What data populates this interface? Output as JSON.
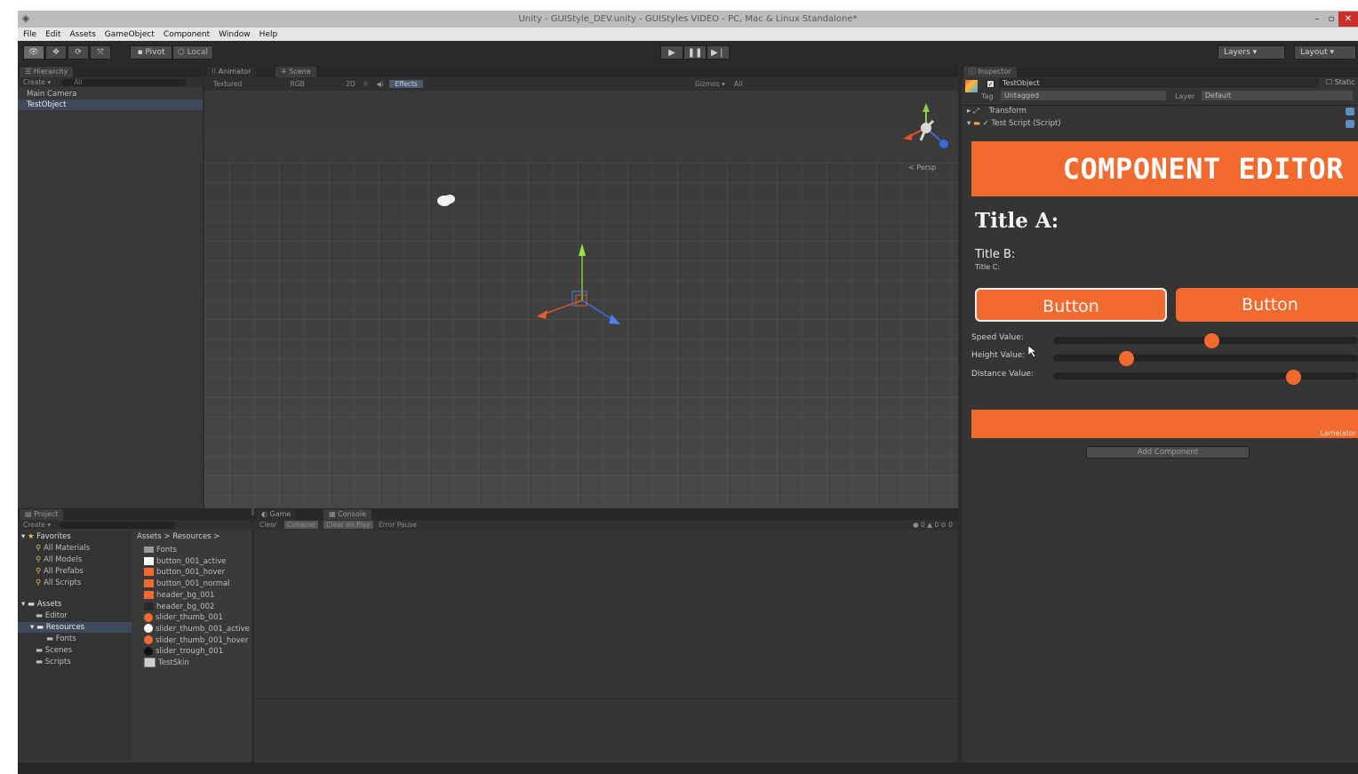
{
  "window": {
    "title": "Unity - GUIStyle_DEV.unity - GUIStyles VIDEO - PC, Mac & Linux Standalone*"
  },
  "menu": [
    "File",
    "Edit",
    "Assets",
    "GameObject",
    "Component",
    "Window",
    "Help"
  ],
  "toolbar": {
    "pivot": "Pivot",
    "local": "Local",
    "layers": "Layers",
    "layout": "Layout"
  },
  "hierarchy": {
    "tab": "Hierarchy",
    "create": "Create",
    "search": "All",
    "items": [
      "Main Camera",
      "TestObject"
    ]
  },
  "scene": {
    "tabs": [
      "Animator",
      "Scene"
    ],
    "shading": "Textured",
    "render": "RGB",
    "mode": "2D",
    "effects": "Effects",
    "gizmos": "Gizmos",
    "search": "All",
    "persp": "< Persp"
  },
  "inspector": {
    "tab": "Inspector",
    "object_name": "TestObject",
    "static": "Static",
    "tag_label": "Tag",
    "tag_value": "Untagged",
    "layer_label": "Layer",
    "layer_value": "Default",
    "transform": "Transform",
    "script": "Test Script (Script)",
    "add_component": "Add Component"
  },
  "component_editor": {
    "header": "COMPONENT EDITOR",
    "title_a": "Title A:",
    "title_b": "Title B:",
    "title_c": "Title C:",
    "button1": "Button",
    "button2": "Button",
    "footer": "Lamelator",
    "sliders": [
      {
        "label": "Speed Value:",
        "value": 0.52
      },
      {
        "label": "Height Value:",
        "value": 0.24
      },
      {
        "label": "Distance Value:",
        "value": 0.79
      }
    ]
  },
  "project": {
    "tab": "Project",
    "create": "Create",
    "favorites": "Favorites",
    "favorite_items": [
      "All Materials",
      "All Models",
      "All Prefabs",
      "All Scripts"
    ],
    "assets": "Assets",
    "asset_folders": [
      "Editor",
      "Resources",
      "Fonts",
      "Scenes",
      "Scripts"
    ],
    "breadcrumb": "Assets > Resources >",
    "files": [
      {
        "name": "Fonts",
        "icon": "folder"
      },
      {
        "name": "button_001_active",
        "icon": "white"
      },
      {
        "name": "button_001_hover",
        "icon": "orange"
      },
      {
        "name": "button_001_normal",
        "icon": "orange"
      },
      {
        "name": "header_bg_001",
        "icon": "orange"
      },
      {
        "name": "header_bg_002",
        "icon": "dark"
      },
      {
        "name": "slider_thumb_001",
        "icon": "orange-circle"
      },
      {
        "name": "slider_thumb_001_active",
        "icon": "white-circle"
      },
      {
        "name": "slider_thumb_001_hover",
        "icon": "orange-circle"
      },
      {
        "name": "slider_trough_001",
        "icon": "black-circle"
      },
      {
        "name": "TestSkin",
        "icon": "skin"
      }
    ]
  },
  "console": {
    "tabs": [
      "Game",
      "Console"
    ],
    "buttons": [
      "Clear",
      "Collapse",
      "Clear on Play",
      "Error Pause"
    ]
  },
  "colors": {
    "accent": "#f36a2f"
  }
}
